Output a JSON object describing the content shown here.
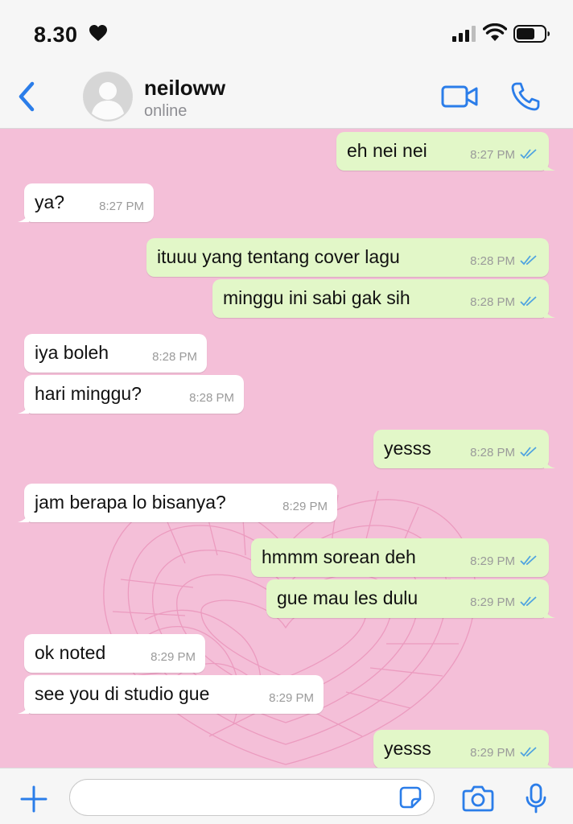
{
  "status_bar": {
    "time": "8.30",
    "icons": [
      "heart-icon",
      "signal-icon",
      "wifi-icon",
      "battery-icon"
    ]
  },
  "header": {
    "contact_name": "neiloww",
    "contact_status": "online",
    "icons": [
      "chevron-left-icon",
      "avatar-placeholder",
      "video-call-icon",
      "phone-icon"
    ]
  },
  "messages": [
    {
      "dir": "out",
      "text": "eh nei nei",
      "time": "8:27 PM",
      "tail": true
    },
    {
      "dir": "in",
      "text": "ya?",
      "time": "8:27 PM",
      "tail": true
    },
    {
      "dir": "out",
      "text": "ituuu yang tentang cover lagu",
      "time": "8:28 PM",
      "tail": false
    },
    {
      "dir": "out",
      "text": "minggu ini sabi gak sih",
      "time": "8:28 PM",
      "tail": true
    },
    {
      "dir": "in",
      "text": "iya boleh",
      "time": "8:28 PM",
      "tail": false
    },
    {
      "dir": "in",
      "text": "hari minggu?",
      "time": "8:28 PM",
      "tail": true
    },
    {
      "dir": "out",
      "text": "yesss",
      "time": "8:28 PM",
      "tail": true
    },
    {
      "dir": "in",
      "text": "jam berapa lo bisanya?",
      "time": "8:29 PM",
      "tail": true
    },
    {
      "dir": "out",
      "text": "hmmm sorean deh",
      "time": "8:29 PM",
      "tail": false
    },
    {
      "dir": "out",
      "text": "gue mau les dulu",
      "time": "8:29 PM",
      "tail": true
    },
    {
      "dir": "in",
      "text": "ok noted",
      "time": "8:29 PM",
      "tail": false
    },
    {
      "dir": "in",
      "text": "see you di studio gue",
      "time": "8:29 PM",
      "tail": true
    },
    {
      "dir": "out",
      "text": "yesss",
      "time": "8:29 PM",
      "tail": true
    }
  ],
  "input_bar": {
    "placeholder": "",
    "value": "",
    "icons": [
      "plus-icon",
      "sticker-icon",
      "camera-icon",
      "microphone-icon"
    ]
  },
  "colors": {
    "accent": "#2b7de9",
    "chat_background": "#f4bfd8",
    "outgoing_bubble": "#e2f7c8",
    "incoming_bubble": "#ffffff",
    "read_tick": "#4fa3e0"
  }
}
